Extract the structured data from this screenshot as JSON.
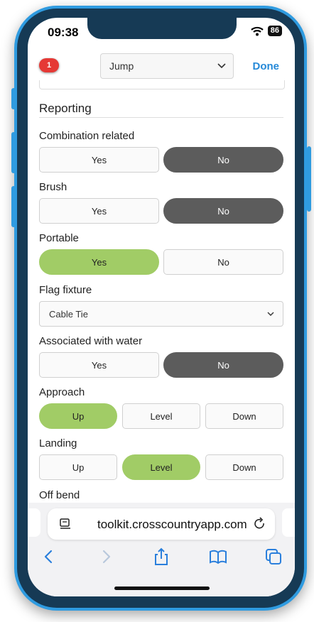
{
  "status": {
    "time": "09:38",
    "battery": "86"
  },
  "header": {
    "badge_count": "1",
    "select_value": "Jump",
    "done_label": "Done"
  },
  "section": {
    "title": "Reporting"
  },
  "fields": {
    "combination_related": {
      "label": "Combination related",
      "yes": "Yes",
      "no": "No",
      "selected": "No"
    },
    "brush": {
      "label": "Brush",
      "yes": "Yes",
      "no": "No",
      "selected": "No"
    },
    "portable": {
      "label": "Portable",
      "yes": "Yes",
      "no": "No",
      "selected": "Yes"
    },
    "flag_fixture": {
      "label": "Flag fixture",
      "value": "Cable Tie"
    },
    "associated_with_water": {
      "label": "Associated with water",
      "yes": "Yes",
      "no": "No",
      "selected": "No"
    },
    "approach": {
      "label": "Approach",
      "up": "Up",
      "level": "Level",
      "down": "Down",
      "selected": "Up"
    },
    "landing": {
      "label": "Landing",
      "up": "Up",
      "level": "Level",
      "down": "Down",
      "selected": "Level"
    },
    "off_bend": {
      "label": "Off bend"
    }
  },
  "browser": {
    "url": "toolkit.crosscountryapp.com"
  },
  "colors": {
    "accent": "#2589d8",
    "selected_green": "#a1cc66",
    "selected_dark": "#5c5c5c",
    "badge": "#e53935",
    "frame": "#2f9be0"
  }
}
